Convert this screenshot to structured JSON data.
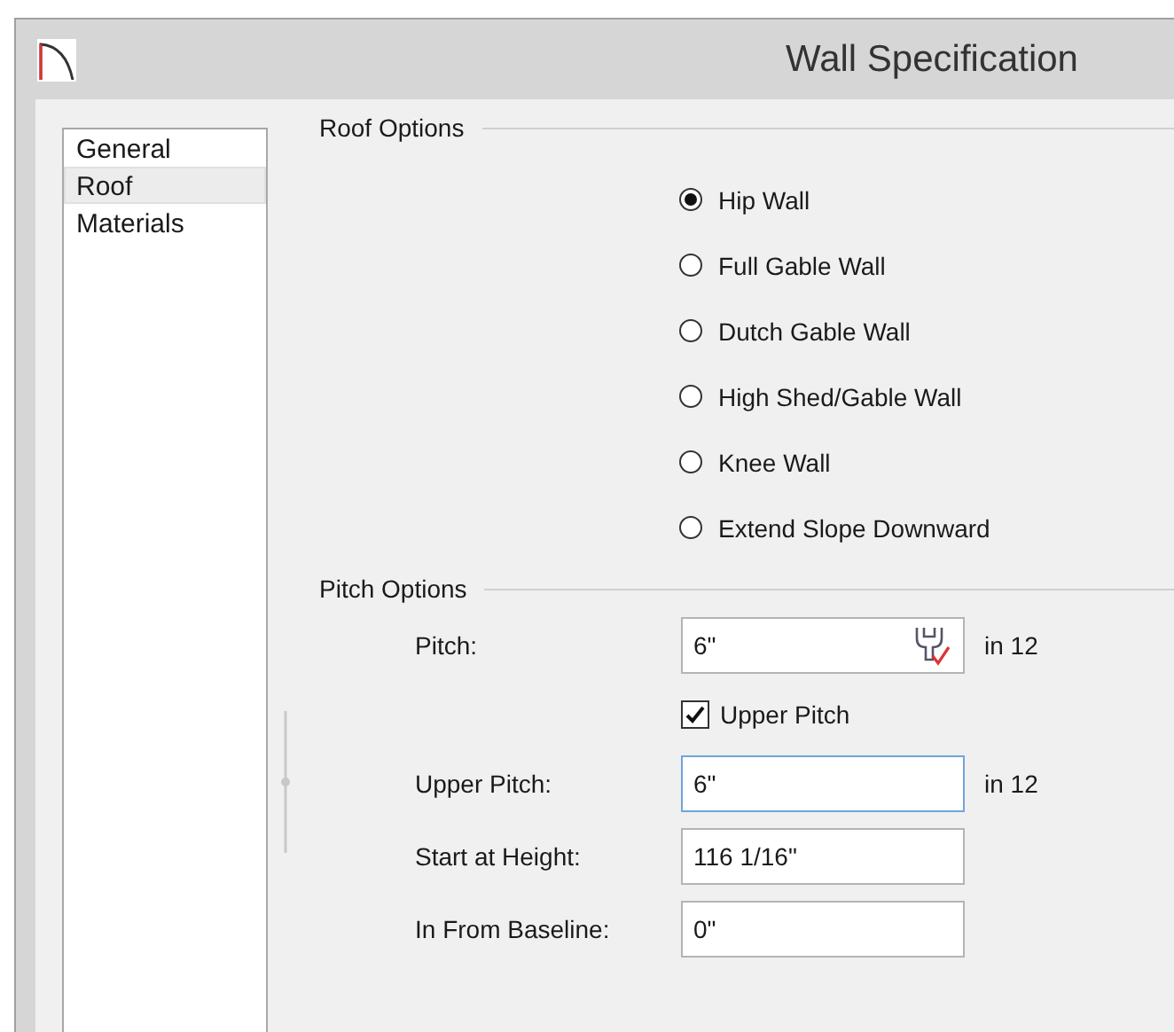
{
  "window": {
    "title": "Wall Specification"
  },
  "sidebar": {
    "items": [
      {
        "label": "General",
        "selected": false
      },
      {
        "label": "Roof",
        "selected": true
      },
      {
        "label": "Materials",
        "selected": false
      }
    ]
  },
  "roof_options": {
    "title": "Roof Options",
    "options": [
      {
        "label": "Hip Wall",
        "selected": true
      },
      {
        "label": "Full Gable Wall",
        "selected": false
      },
      {
        "label": "Dutch Gable Wall",
        "selected": false
      },
      {
        "label": "High Shed/Gable Wall",
        "selected": false
      },
      {
        "label": "Knee Wall",
        "selected": false
      },
      {
        "label": "Extend Slope Downward",
        "selected": false
      }
    ]
  },
  "pitch_options": {
    "title": "Pitch Options",
    "rows": [
      {
        "kind": "field",
        "label": "Pitch:",
        "value": "6\"",
        "unit": "in 12",
        "focused": false,
        "tool": true
      },
      {
        "kind": "checkbox",
        "label": "Upper Pitch",
        "checked": true
      },
      {
        "kind": "field",
        "label": "Upper Pitch:",
        "value": "6\"",
        "unit": "in 12",
        "focused": true,
        "tool": false
      },
      {
        "kind": "field",
        "label": "Start at Height:",
        "value": "116 1/16\"",
        "focused": false,
        "tool": false
      },
      {
        "kind": "field",
        "label": "In From Baseline:",
        "value": "0\"",
        "focused": false,
        "tool": false
      }
    ]
  }
}
